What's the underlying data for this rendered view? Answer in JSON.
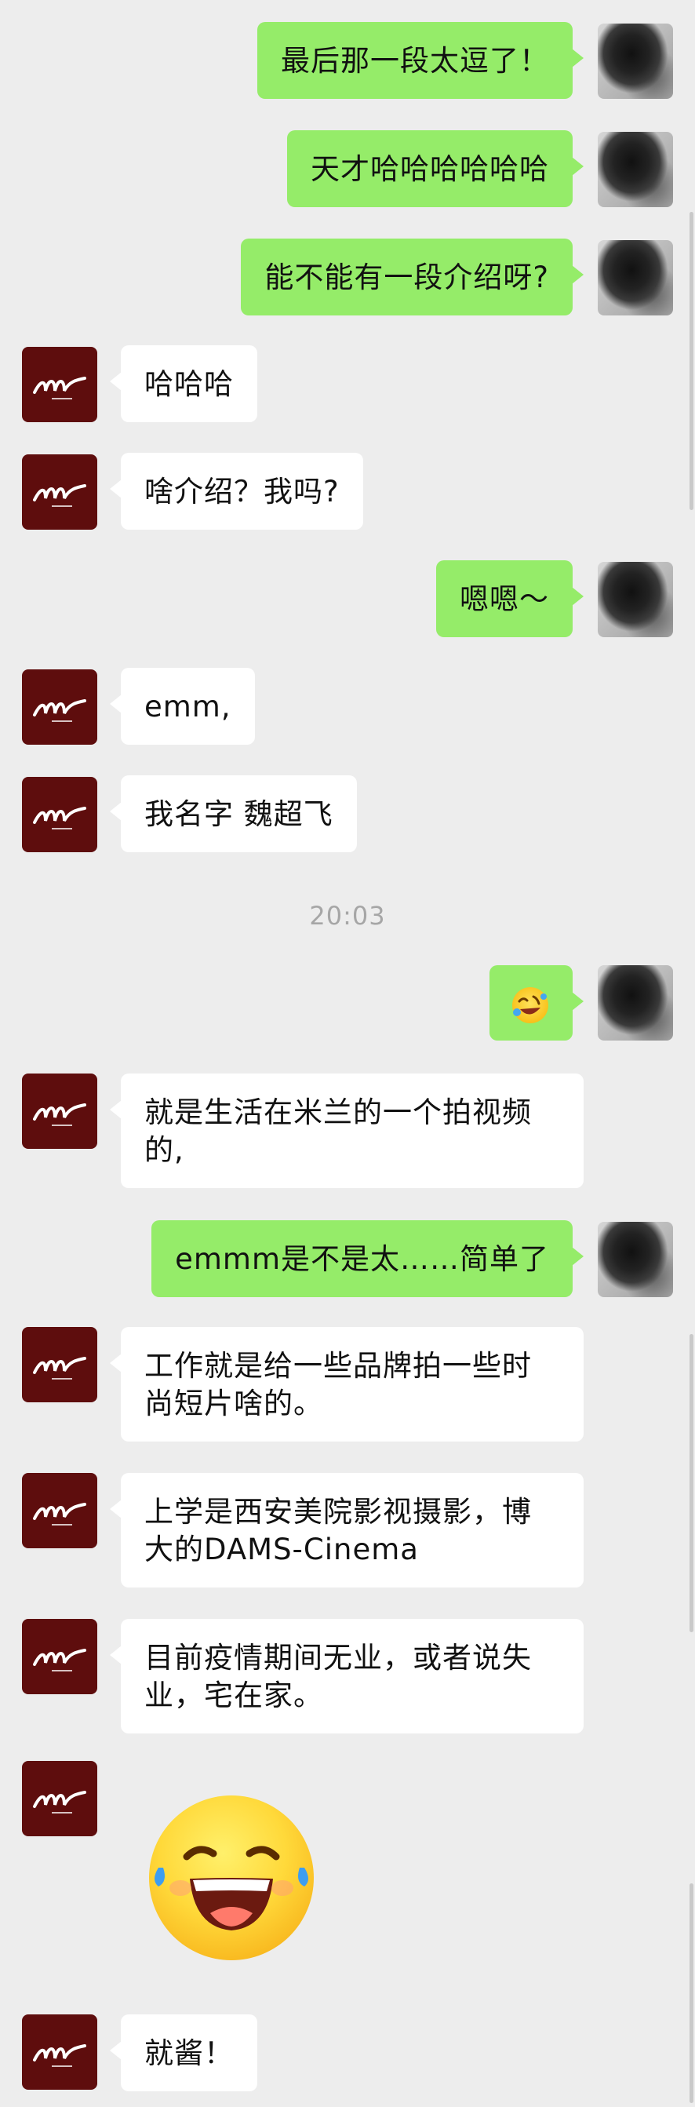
{
  "messages": [
    {
      "from": "me",
      "text": "最后那一段太逗了！"
    },
    {
      "from": "me",
      "text": "天才哈哈哈哈哈哈"
    },
    {
      "from": "me",
      "text": "能不能有一段介绍呀?"
    },
    {
      "from": "other",
      "text": "哈哈哈"
    },
    {
      "from": "other",
      "text": "啥介绍？我吗?"
    },
    {
      "from": "me",
      "text": "嗯嗯～"
    },
    {
      "from": "other",
      "text": "emm,"
    },
    {
      "from": "other",
      "text": "我名字 魏超飞"
    },
    {
      "from": "me",
      "sticker": "rofl-emoji"
    },
    {
      "from": "other",
      "text": "就是生活在米兰的一个拍视频的,"
    },
    {
      "from": "me",
      "text": "emmm是不是太……简单了"
    },
    {
      "from": "other",
      "text": "工作就是给一些品牌拍一些时尚短片啥的。"
    },
    {
      "from": "other",
      "text": "上学是西安美院影视摄影，博大的DAMS-Cinema"
    },
    {
      "from": "other",
      "text": "目前疫情期间无业，或者说失业，宅在家。"
    },
    {
      "from": "other",
      "sticker": "laughing-tears-emoji"
    },
    {
      "from": "other",
      "text": "就酱！"
    }
  ],
  "timestamp": "20:03",
  "colors": {
    "background": "#ededed",
    "my_bubble": "#95ec69",
    "other_bubble": "#ffffff",
    "other_avatar": "#5e0d0d"
  }
}
